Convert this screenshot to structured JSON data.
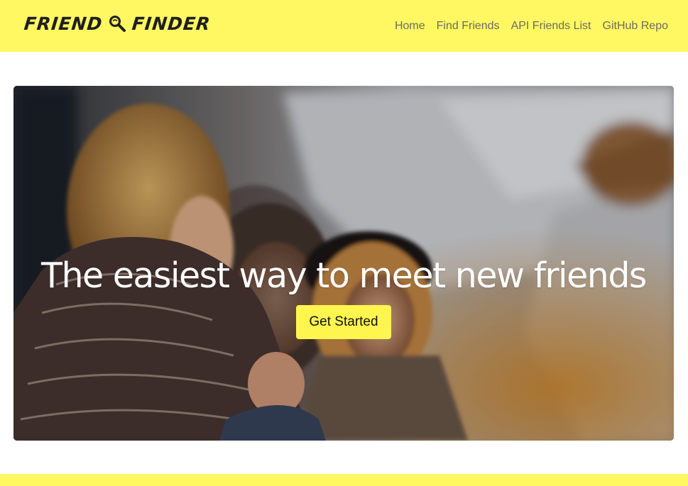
{
  "brand": {
    "word1": "FRIEND",
    "word2": "FINDER",
    "icon": "magnifier-icon"
  },
  "nav": {
    "items": [
      {
        "label": "Home"
      },
      {
        "label": "Find Friends"
      },
      {
        "label": "API Friends List"
      },
      {
        "label": "GitHub Repo"
      }
    ]
  },
  "hero": {
    "title": "The easiest way to meet new friends",
    "cta_label": "Get Started"
  },
  "colors": {
    "navbar_bg": "#fff862",
    "cta_bg": "#fff54f",
    "nav_text": "#6b6b63",
    "hero_text": "#ffffff"
  }
}
